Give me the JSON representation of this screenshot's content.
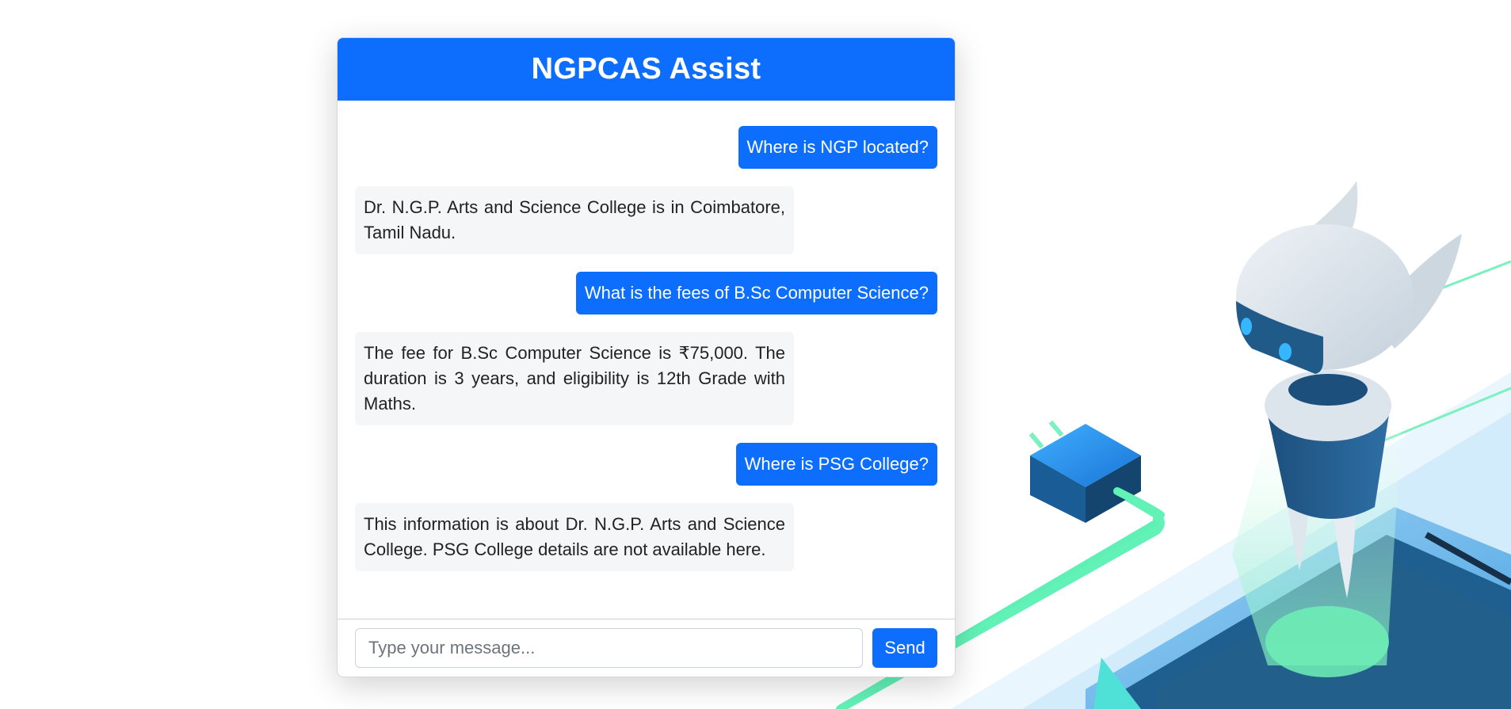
{
  "colors": {
    "accent": "#0d6efd",
    "bot_bubble": "#f5f6f8"
  },
  "chat": {
    "title": "NGPCAS Assist",
    "messages": [
      {
        "role": "user",
        "text": "Where is NGP located?"
      },
      {
        "role": "bot",
        "text": "Dr. N.G.P. Arts and Science College is in Coimbatore, Tamil Nadu."
      },
      {
        "role": "user",
        "text": "What is the fees of B.Sc Computer Science?"
      },
      {
        "role": "bot",
        "text": "The fee for B.Sc Computer Science is ₹75,000. The duration is 3 years, and eligibility is 12th Grade with Maths."
      },
      {
        "role": "user",
        "text": "Where is PSG College?"
      },
      {
        "role": "bot",
        "text": "This information is about Dr. N.G.P. Arts and Science College. PSG College details are not available here."
      }
    ],
    "input": {
      "placeholder": "Type your message...",
      "value": ""
    },
    "send_label": "Send"
  },
  "illustration": {
    "robot_icon": "robot-icon",
    "plug_icon": "power-plug-icon"
  }
}
